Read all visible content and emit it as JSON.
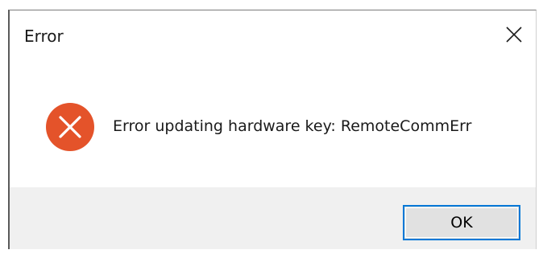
{
  "window": {
    "title": "Error",
    "close_icon": "close-icon"
  },
  "content": {
    "icon": "error-icon",
    "icon_color": "#e4532a",
    "message": "Error updating hardware key: RemoteCommErr"
  },
  "footer": {
    "ok_label": "OK",
    "button_border_color": "#0078d7"
  }
}
